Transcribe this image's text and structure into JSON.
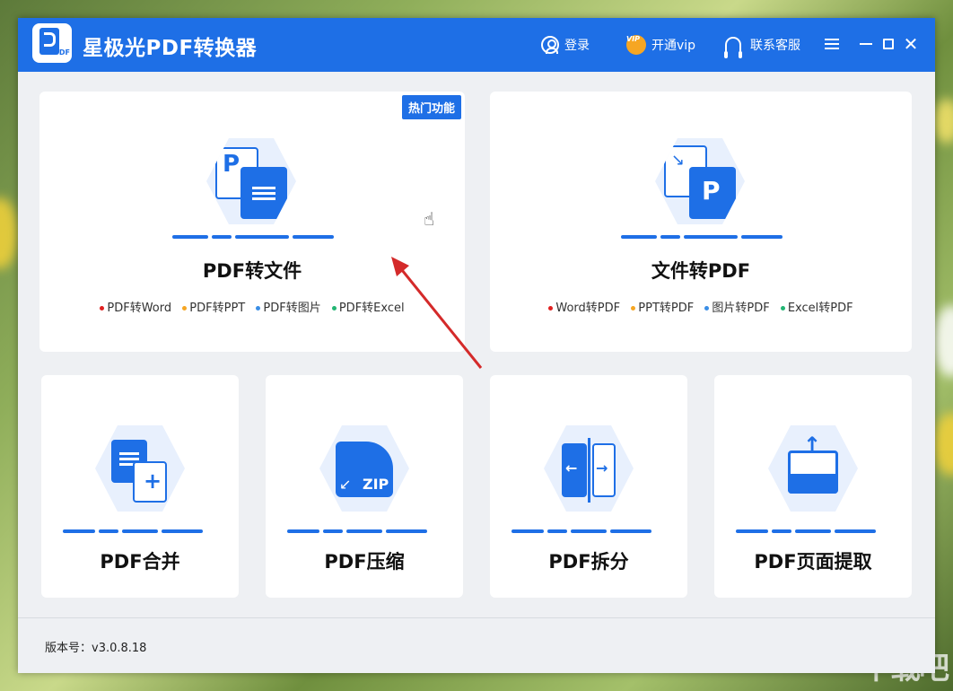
{
  "titlebar": {
    "app_name": "星极光PDF转换器",
    "logo_text": "PDF",
    "login_label": "登录",
    "vip_badge": "VIP",
    "vip_label": "开通vip",
    "service_label": "联系客服"
  },
  "colors": {
    "primary": "#1e6fe6",
    "dot_red": "#e02020",
    "dot_orange": "#f6a623",
    "dot_blue": "#3a8ee6",
    "dot_green": "#22b573",
    "arrow": "#d42a2a"
  },
  "cards_big": [
    {
      "badge": "热门功能",
      "title": "PDF转文件",
      "features": [
        "PDF转Word",
        "PDF转PPT",
        "PDF转图片",
        "PDF转Excel"
      ]
    },
    {
      "title": "文件转PDF",
      "features": [
        "Word转PDF",
        "PPT转PDF",
        "图片转PDF",
        "Excel转PDF"
      ]
    }
  ],
  "cards_small": [
    {
      "title": "PDF合并",
      "icon": "merge-icon"
    },
    {
      "title": "PDF压缩",
      "icon": "zip-icon",
      "icon_text": "ZIP"
    },
    {
      "title": "PDF拆分",
      "icon": "split-icon"
    },
    {
      "title": "PDF页面提取",
      "icon": "extract-icon"
    }
  ],
  "footer": {
    "version": "版本号：v3.0.8.18"
  },
  "watermark": "下载吧"
}
